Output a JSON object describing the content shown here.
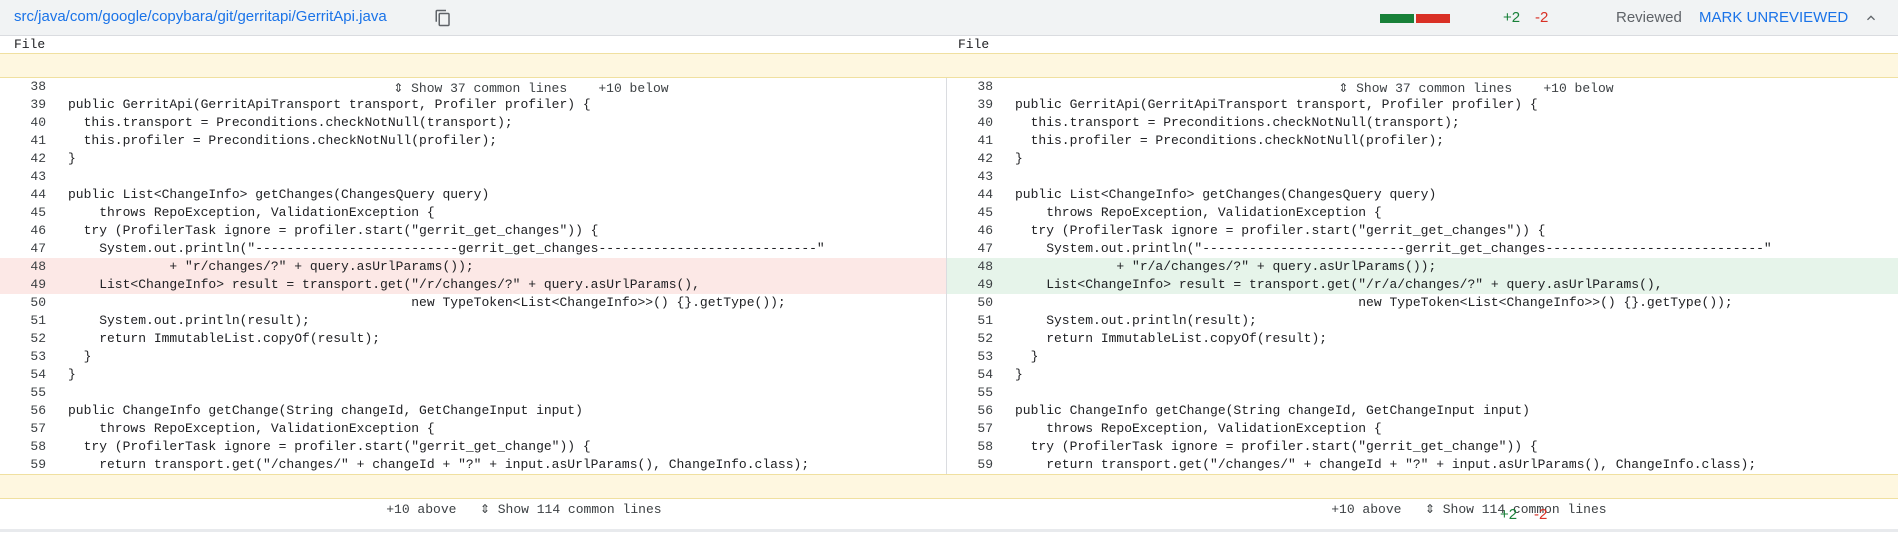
{
  "header": {
    "file_path": "src/java/com/google/copybara/git/gerritapi/GerritApi.java",
    "additions": "+2",
    "deletions": "-2",
    "reviewed_label": "Reviewed",
    "mark_unreviewed_label": "MARK UNREVIEWED"
  },
  "columns": {
    "left": "File",
    "right": "File"
  },
  "context_top": {
    "show_label": "Show 37 common lines",
    "below_label": "+10 below"
  },
  "context_bottom": {
    "above_label": "+10 above",
    "show_label": "Show 114 common lines"
  },
  "footer": {
    "additions": "+2",
    "deletions": "-2"
  },
  "colors": {
    "added_bg": "#e6f4ea",
    "deleted_bg": "#fce8e6",
    "accent": "#1a73e8"
  },
  "left_lines": [
    {
      "n": "38",
      "text": ""
    },
    {
      "n": "39",
      "text": "public GerritApi(GerritApiTransport transport, Profiler profiler) {"
    },
    {
      "n": "40",
      "text": "  this.transport = Preconditions.checkNotNull(transport);"
    },
    {
      "n": "41",
      "text": "  this.profiler = Preconditions.checkNotNull(profiler);"
    },
    {
      "n": "42",
      "text": "}"
    },
    {
      "n": "43",
      "text": ""
    },
    {
      "n": "44",
      "text": "public List<ChangeInfo> getChanges(ChangesQuery query)"
    },
    {
      "n": "45",
      "text": "    throws RepoException, ValidationException {"
    },
    {
      "n": "46",
      "text": "  try (ProfilerTask ignore = profiler.start(\"gerrit_get_changes\")) {"
    },
    {
      "n": "47",
      "text": "    System.out.println(\"--------------------------gerrit_get_changes----------------------------\""
    },
    {
      "n": "48",
      "text": "             + \"r/changes/?\" + query.asUrlParams());"
    },
    {
      "n": "49",
      "text": "    List<ChangeInfo> result = transport.get(\"/r/changes/?\" + query.asUrlParams(),"
    },
    {
      "n": "50",
      "text": "                                            new TypeToken<List<ChangeInfo>>() {}.getType());"
    },
    {
      "n": "51",
      "text": "    System.out.println(result);"
    },
    {
      "n": "52",
      "text": "    return ImmutableList.copyOf(result);"
    },
    {
      "n": "53",
      "text": "  }"
    },
    {
      "n": "54",
      "text": "}"
    },
    {
      "n": "55",
      "text": ""
    },
    {
      "n": "56",
      "text": "public ChangeInfo getChange(String changeId, GetChangeInput input)"
    },
    {
      "n": "57",
      "text": "    throws RepoException, ValidationException {"
    },
    {
      "n": "58",
      "text": "  try (ProfilerTask ignore = profiler.start(\"gerrit_get_change\")) {"
    },
    {
      "n": "59",
      "text": "    return transport.get(\"/changes/\" + changeId + \"?\" + input.asUrlParams(), ChangeInfo.class);"
    }
  ],
  "right_lines": [
    {
      "n": "38",
      "text": ""
    },
    {
      "n": "39",
      "text": "public GerritApi(GerritApiTransport transport, Profiler profiler) {"
    },
    {
      "n": "40",
      "text": "  this.transport = Preconditions.checkNotNull(transport);"
    },
    {
      "n": "41",
      "text": "  this.profiler = Preconditions.checkNotNull(profiler);"
    },
    {
      "n": "42",
      "text": "}"
    },
    {
      "n": "43",
      "text": ""
    },
    {
      "n": "44",
      "text": "public List<ChangeInfo> getChanges(ChangesQuery query)"
    },
    {
      "n": "45",
      "text": "    throws RepoException, ValidationException {"
    },
    {
      "n": "46",
      "text": "  try (ProfilerTask ignore = profiler.start(\"gerrit_get_changes\")) {"
    },
    {
      "n": "47",
      "text": "    System.out.println(\"--------------------------gerrit_get_changes----------------------------\""
    },
    {
      "n": "48",
      "text": "             + \"r/a/changes/?\" + query.asUrlParams());"
    },
    {
      "n": "49",
      "text": "    List<ChangeInfo> result = transport.get(\"/r/a/changes/?\" + query.asUrlParams(),"
    },
    {
      "n": "50",
      "text": "                                            new TypeToken<List<ChangeInfo>>() {}.getType());"
    },
    {
      "n": "51",
      "text": "    System.out.println(result);"
    },
    {
      "n": "52",
      "text": "    return ImmutableList.copyOf(result);"
    },
    {
      "n": "53",
      "text": "  }"
    },
    {
      "n": "54",
      "text": "}"
    },
    {
      "n": "55",
      "text": ""
    },
    {
      "n": "56",
      "text": "public ChangeInfo getChange(String changeId, GetChangeInput input)"
    },
    {
      "n": "57",
      "text": "    throws RepoException, ValidationException {"
    },
    {
      "n": "58",
      "text": "  try (ProfilerTask ignore = profiler.start(\"gerrit_get_change\")) {"
    },
    {
      "n": "59",
      "text": "    return transport.get(\"/changes/\" + changeId + \"?\" + input.asUrlParams(), ChangeInfo.class);"
    }
  ]
}
